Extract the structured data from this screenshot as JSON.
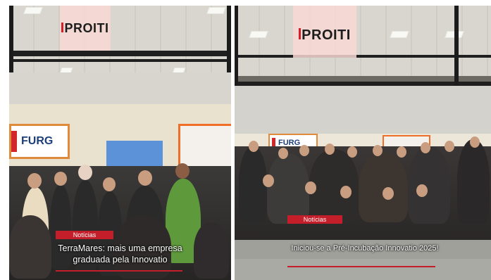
{
  "cards": [
    {
      "logo_text": "PROITI",
      "badge": "Notícias",
      "title_line1": "TerraMares: mais uma empresa",
      "title_line2": "graduada pela Innovatio",
      "sign_text": "FURG"
    },
    {
      "logo_text": "PROITI",
      "badge": "Notícias",
      "title_line1": "Iniciou-se a Pré-Incubação Innovatio 2025!",
      "sign_text": "FURG"
    }
  ],
  "colors": {
    "accent": "#c41e2a",
    "logo_bg": "#f7d8d4",
    "furg_border": "#e08a3c"
  }
}
